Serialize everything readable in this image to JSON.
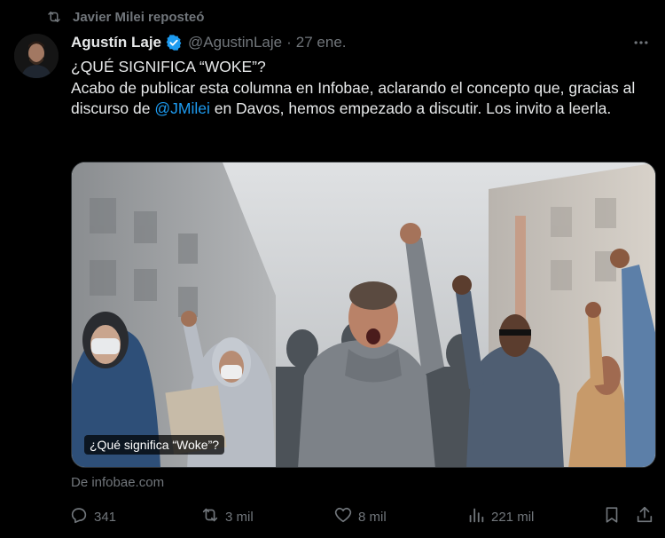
{
  "repost": {
    "text": "Javier Milei reposteó",
    "icon": "repost-icon"
  },
  "tweet": {
    "author": {
      "name": "Agustín Laje",
      "verified": true,
      "handle": "@AgustinLaje",
      "date_separator": "·",
      "date": "27 ene."
    },
    "text": {
      "line1": "¿QUÉ SIGNIFICA “WOKE”?",
      "part1": "Acabo de publicar esta columna en Infobae, aclarando el concepto que, gracias al discurso de ",
      "mention": "@JMilei",
      "part2": " en Davos, hemos empezado a discutir. Los invito a leerla."
    },
    "card": {
      "caption": "¿Qué significa “Woke”?",
      "source": "De infobae.com"
    },
    "actions": {
      "replies": "341",
      "reposts": "3 mil",
      "likes": "8 mil",
      "views": "221 mil"
    }
  },
  "colors": {
    "background": "#000000",
    "text": "#e7e9ea",
    "muted": "#71767b",
    "accent": "#1d9bf0"
  },
  "icons": [
    "repost-icon",
    "verified-badge-icon",
    "more-icon",
    "reply-icon",
    "like-icon",
    "views-icon",
    "bookmark-icon",
    "share-icon"
  ]
}
